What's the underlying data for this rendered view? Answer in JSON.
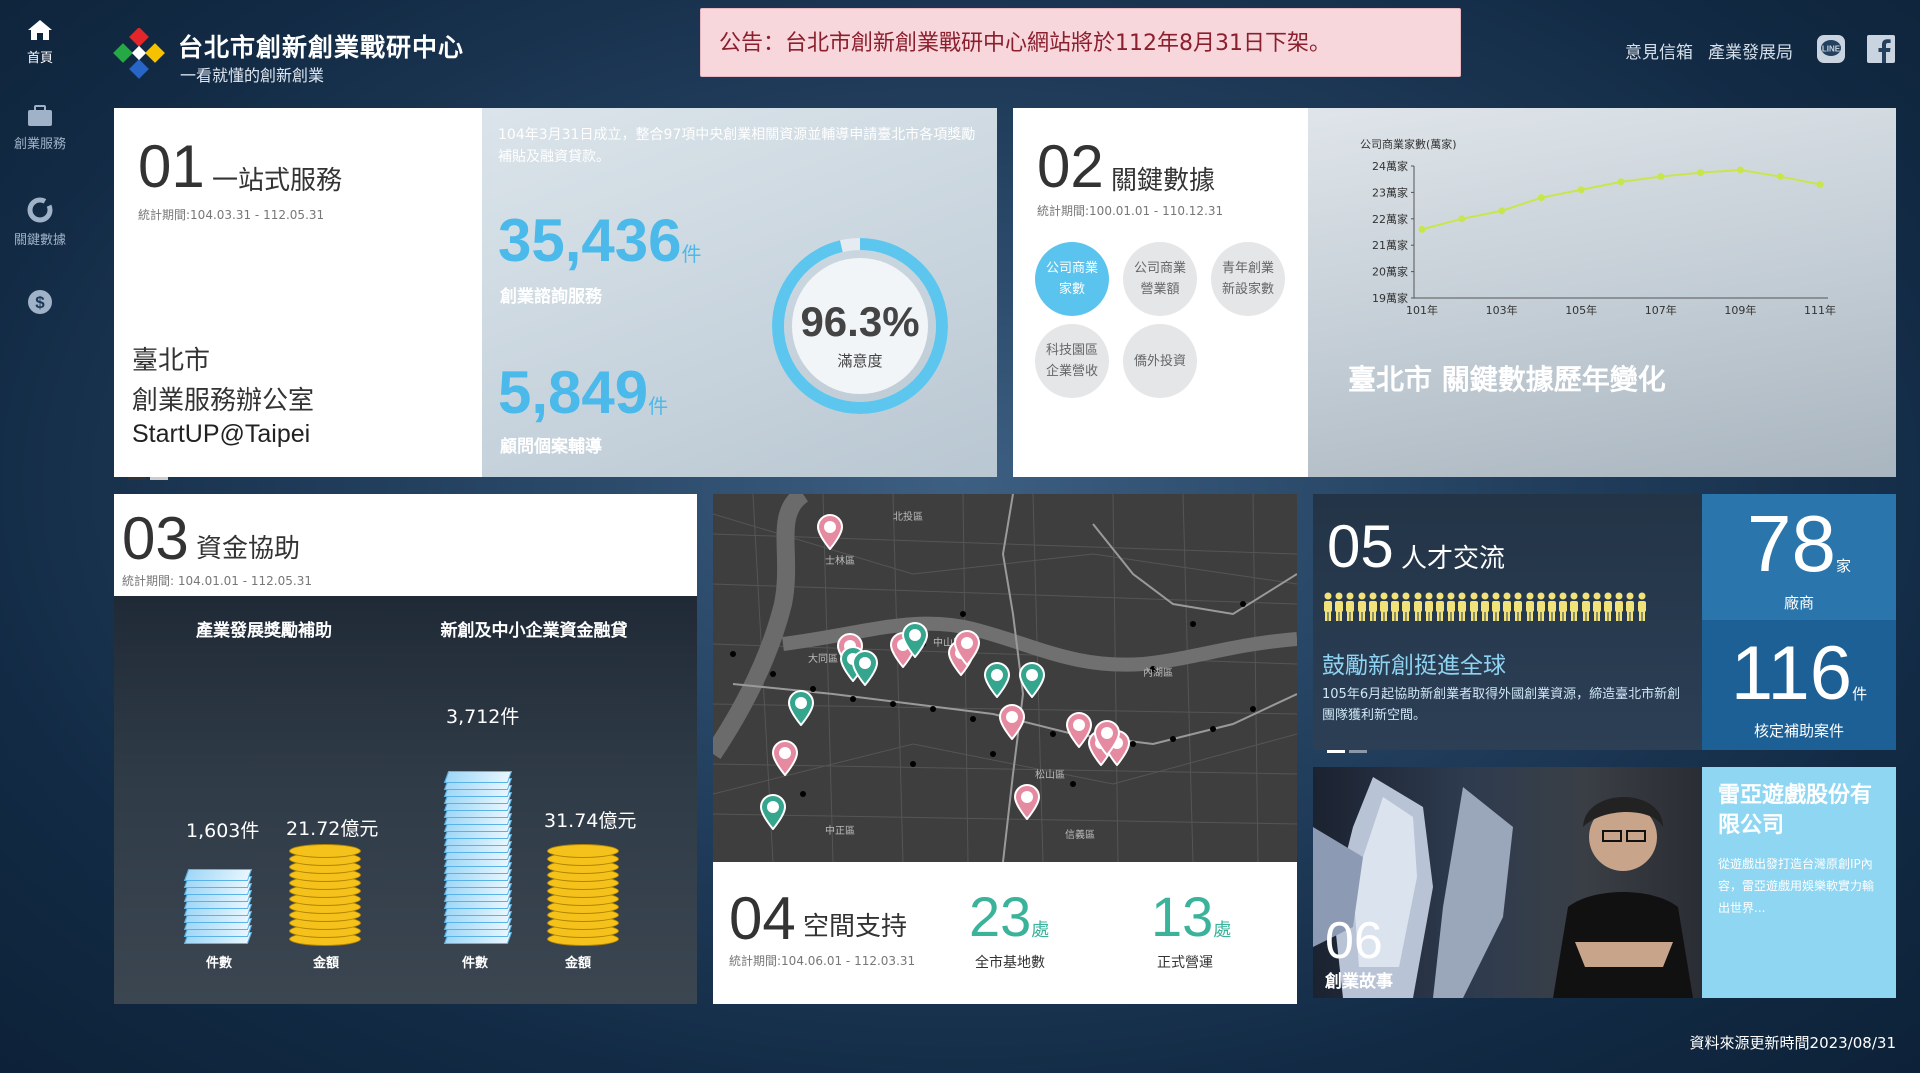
{
  "sidebar": {
    "items": [
      {
        "label": "首頁",
        "icon": "home-icon"
      },
      {
        "label": "創業服務",
        "icon": "briefcase-icon"
      },
      {
        "label": "關鍵數據",
        "icon": "donut-chart-icon"
      },
      {
        "label": "",
        "icon": "dollar-icon"
      }
    ]
  },
  "header": {
    "title": "台北市創新創業戰研中心",
    "subtitle": "一看就懂的創新創業",
    "notice": "公告：台北市創新創業戰研中心網站將於112年8月31日下架。",
    "links": [
      "意見信箱",
      "產業發展局"
    ],
    "icons": [
      "line-icon",
      "facebook-icon"
    ]
  },
  "panel01": {
    "num": "01",
    "title": "一站式服務",
    "period": "統計期間:104.03.31 - 112.05.31",
    "org_line1": "臺北市",
    "org_line2": "創業服務辦公室",
    "org_line3": "StartUP@Taipei",
    "desc": "104年3月31日成立，整合97項中央創業相關資源並輔導申請臺北市各項獎勵補貼及融資貸款。",
    "stat1_value": "35,436",
    "stat1_unit": "件",
    "stat1_label": "創業諮詢服務",
    "stat2_value": "5,849",
    "stat2_unit": "件",
    "stat2_label": "顧問個案輔導",
    "satisfaction": "96.3%",
    "satisfaction_label": "滿意度",
    "satisfaction_fraction": 0.963
  },
  "panel02": {
    "num": "02",
    "title": "關鍵數據",
    "period": "統計期間:100.01.01 - 110.12.31",
    "bubbles": [
      {
        "l1": "公司商業",
        "l2": "家數",
        "active": true
      },
      {
        "l1": "公司商業",
        "l2": "營業額",
        "active": false
      },
      {
        "l1": "青年創業",
        "l2": "新設家數",
        "active": false
      },
      {
        "l1": "科技園區",
        "l2": "企業營收",
        "active": false
      },
      {
        "l1": "僑外投資",
        "l2": "",
        "active": false
      }
    ],
    "caption": "臺北市 關鍵數據歷年變化"
  },
  "chart_data": {
    "type": "line",
    "ylabel": "公司商業家數(萬家)",
    "x": [
      "101年",
      "102年",
      "103年",
      "104年",
      "105年",
      "106年",
      "107年",
      "108年",
      "109年",
      "110年",
      "111年"
    ],
    "x_ticks": [
      "101年",
      "103年",
      "105年",
      "107年",
      "109年",
      "111年"
    ],
    "y_ticks": [
      "19萬家",
      "20萬家",
      "21萬家",
      "22萬家",
      "23萬家",
      "24萬家"
    ],
    "ylim": [
      19,
      24
    ],
    "series": [
      {
        "values": [
          21.6,
          22.0,
          22.3,
          22.8,
          23.1,
          23.4,
          23.6,
          23.75,
          23.85,
          23.6,
          23.3
        ],
        "color": "#c8e64c"
      }
    ],
    "grid": false
  },
  "panel03": {
    "num": "03",
    "title": "資金協助",
    "period": "統計期間: 104.01.01 - 112.05.31",
    "left_title": "產業發展獎勵補助",
    "right_title": "新創及中小企業資金融貸",
    "left_count": "1,603件",
    "left_amount": "21.72億元",
    "right_count": "3,712件",
    "right_amount": "31.74億元",
    "lbl_count": "件數",
    "lbl_amount": "金額"
  },
  "panel04": {
    "num": "04",
    "title": "空間支持",
    "period": "統計期間:104.06.01 - 112.03.31",
    "stat1_value": "23",
    "stat1_unit": "處",
    "stat1_label": "全市基地數",
    "stat2_value": "13",
    "stat2_unit": "處",
    "stat2_label": "正式營運",
    "map_labels": [
      "士林區",
      "中山區",
      "大同區",
      "松山區",
      "內湖區",
      "信義區",
      "中正區",
      "北投區"
    ]
  },
  "panel05": {
    "num": "05",
    "title": "人才交流",
    "headline": "鼓勵新創挺進全球",
    "desc": "105年6月起協助新創業者取得外國創業資源，締造臺北市新創團隊獲利新空間。",
    "stat1_value": "78",
    "stat1_unit": "家",
    "stat1_label": "廠商",
    "stat2_value": "116",
    "stat2_unit": "件",
    "stat2_label": "核定補助案件"
  },
  "panel06": {
    "num": "06",
    "title": "創業故事",
    "company": "雷亞遊戲股份有限公司",
    "desc": "從遊戲出發打造台灣原創IP內容，雷亞遊戲用娛樂軟實力輸出世界..."
  },
  "footer": {
    "updated": "資料來源更新時間2023/08/31"
  }
}
